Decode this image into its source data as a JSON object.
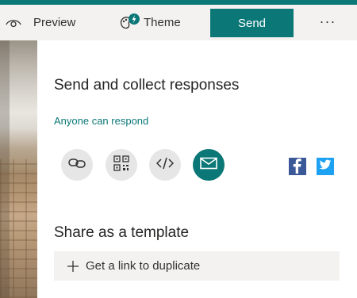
{
  "toolbar": {
    "preview_label": "Preview",
    "theme_label": "Theme",
    "send_label": "Send",
    "more_label": "···"
  },
  "send_panel": {
    "title": "Send and collect responses",
    "audience_link": "Anyone can respond",
    "share_options": [
      {
        "name": "link",
        "icon": "link-icon"
      },
      {
        "name": "qr-code",
        "icon": "qr-code-icon"
      },
      {
        "name": "embed",
        "icon": "code-embed-icon"
      },
      {
        "name": "email",
        "icon": "email-icon",
        "selected": true
      }
    ],
    "social": [
      {
        "name": "facebook",
        "icon": "facebook-icon",
        "glyph": "f"
      },
      {
        "name": "twitter",
        "icon": "twitter-icon"
      }
    ]
  },
  "template_section": {
    "title": "Share as a template",
    "duplicate_link_label": "Get a link to duplicate"
  },
  "colors": {
    "accent": "#0c7777",
    "toolbar_bg": "#f3f2f1",
    "icon_circle_bg": "#e6e6e6",
    "facebook": "#3b5998",
    "twitter": "#1da1f2"
  }
}
